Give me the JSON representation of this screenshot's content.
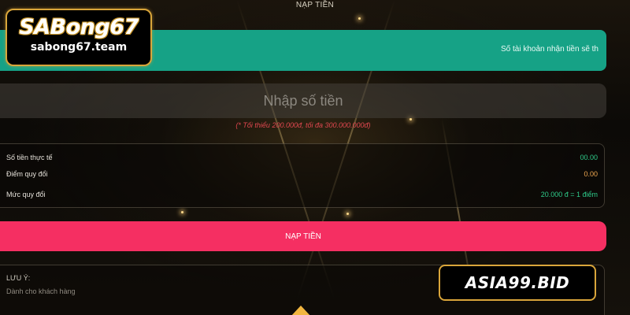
{
  "header": {
    "title": "NẠP TIỀN"
  },
  "account_bar": {
    "text": "Số tài khoản nhận tiền sẽ th"
  },
  "amount_input": {
    "placeholder": "Nhập số tiền",
    "value": ""
  },
  "limit_note": "(* Tối thiểu 200.000đ, tối đa 300.000.000đ)",
  "summary": {
    "rows": [
      {
        "label": "Số tiền thực tế",
        "value": "00.00"
      },
      {
        "label": "Điểm quy đổi",
        "value": "0.00"
      },
      {
        "label": "Mức quy đổi",
        "value": "20.000 đ = 1 điểm"
      }
    ]
  },
  "deposit_button": {
    "label": "NẠP TIỀN"
  },
  "note": {
    "title": "LƯU Ý:",
    "subtitle": "Dành cho khách hàng"
  },
  "logos": {
    "sabong_brand": "SABong67",
    "sabong_site": "sabong67.team",
    "asia": "ASIA99.BID"
  },
  "colors": {
    "account_bar": "#16a286",
    "deposit_button": "#f52f62",
    "limit_note": "#e0474f",
    "value_green": "#2ecc8a",
    "value_orange": "#f0a850",
    "logo_border": "#d9a53a"
  },
  "icons": {
    "scroll_top": "up-arrow-icon"
  }
}
